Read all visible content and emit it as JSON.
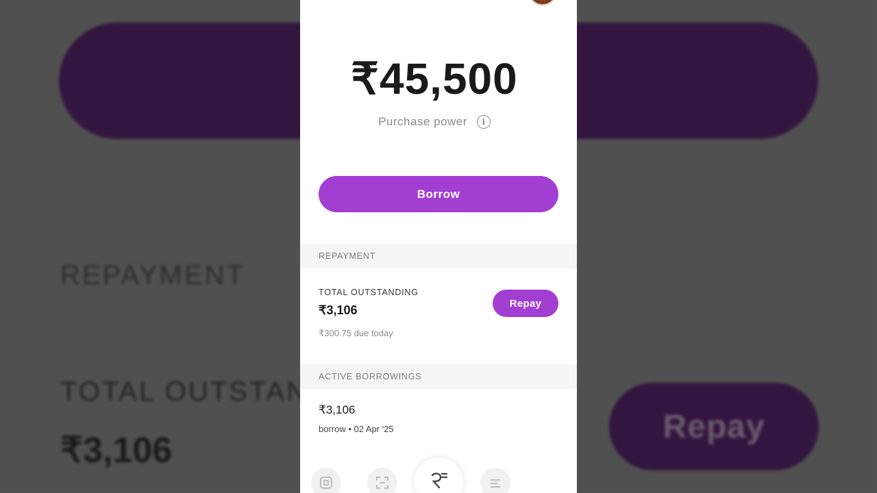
{
  "background": {
    "repayment_label": "REPAYMENT",
    "total_label": "TOTAL OUTSTAND",
    "amount": "₹3,106",
    "repay_label": "Repay"
  },
  "header": {
    "avatar": "user-avatar"
  },
  "balance": {
    "amount": "₹45,500",
    "label": "Purchase power",
    "info_icon_glyph": "i"
  },
  "actions": {
    "borrow_label": "Borrow"
  },
  "repayment": {
    "section_title": "REPAYMENT",
    "total_label": "TOTAL OUTSTANDING",
    "total_amount": "₹3,106",
    "due_text": "₹300.75 due today",
    "repay_label": "Repay"
  },
  "active_borrowings": {
    "section_title": "ACTIVE BORROWINGS",
    "items": [
      {
        "amount": "₹3,106",
        "meta": "borrow • 02 Apr '25"
      }
    ]
  },
  "bottom_nav": {
    "items": [
      "home-icon",
      "scan-icon",
      "rupee-borrow-icon",
      "menu-icon"
    ]
  },
  "colors": {
    "accent": "#a23fd2",
    "background_overlay": "#505050",
    "text_primary": "#1a1a1a",
    "text_secondary": "#8a8a8a"
  }
}
